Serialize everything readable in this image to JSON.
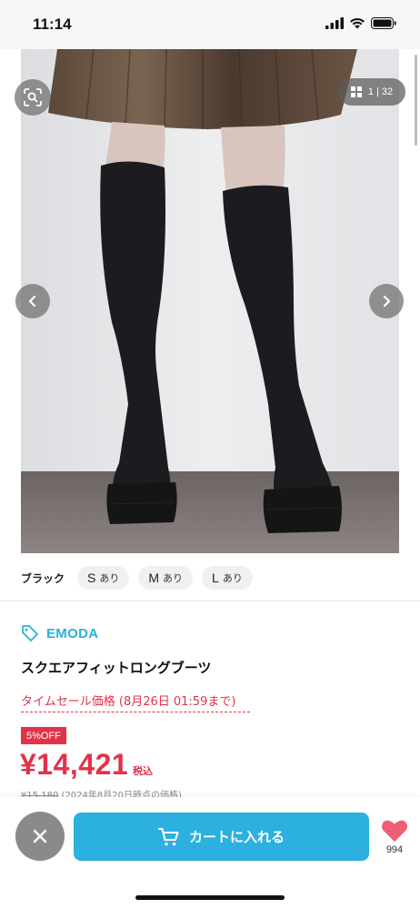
{
  "status_bar": {
    "time": "11:14"
  },
  "gallery": {
    "counter_current": "1",
    "counter_total": "32",
    "counter_separator": "|"
  },
  "stock": {
    "color_name": "ブラック",
    "sizes": [
      {
        "size": "S",
        "availability": "あり"
      },
      {
        "size": "M",
        "availability": "あり"
      },
      {
        "size": "L",
        "availability": "あり"
      }
    ]
  },
  "product": {
    "brand": "EMODA",
    "name": "スクエアフィットロングブーツ",
    "timesale_label": "タイムセール価格 (8月26日 01:59まで)",
    "discount_badge": "5%OFF",
    "price": "¥14,421",
    "tax_label": "税込",
    "original_price": "¥15,180",
    "original_price_note": "(2024年8月20日時点の価格)"
  },
  "actions": {
    "cart_label": "カートに入れる",
    "favorite_count": "994"
  },
  "colors": {
    "accent_blue": "#2bb0e0",
    "sale_red": "#e0334a",
    "brand_blue": "#2bb0d6"
  }
}
